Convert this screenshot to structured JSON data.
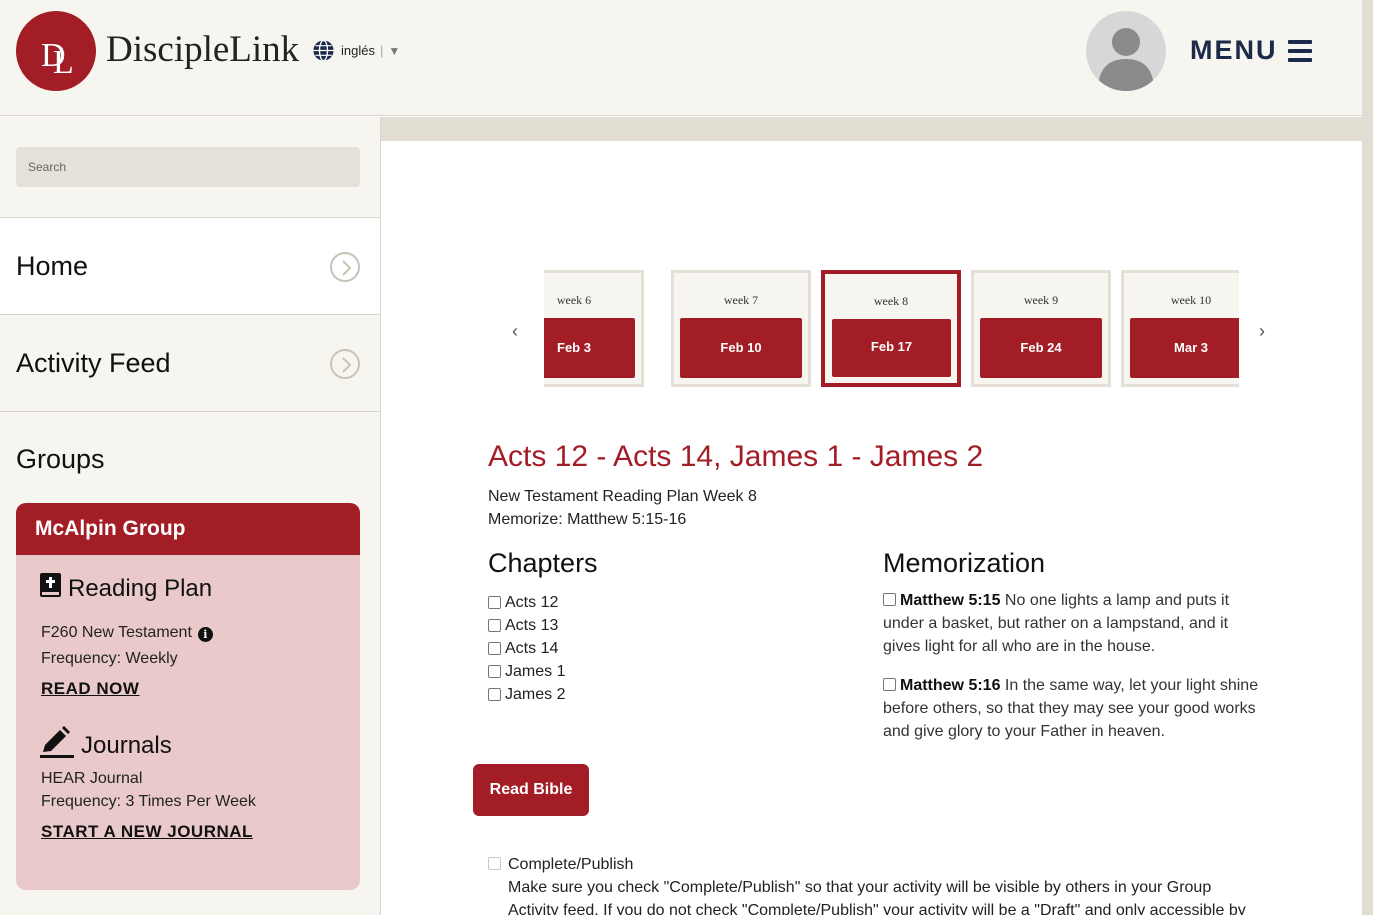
{
  "header": {
    "app_name": "DiscipleLink",
    "logo_letters": "DL",
    "language": "inglés",
    "menu_label": "MENU"
  },
  "sidebar": {
    "search_placeholder": "Search",
    "nav": [
      {
        "label": "Home"
      },
      {
        "label": "Activity Feed"
      }
    ],
    "groups_title": "Groups",
    "group": {
      "name": "McAlpin Group",
      "reading_plan": {
        "title": "Reading Plan",
        "plan_name": "F260 New Testament",
        "frequency": "Frequency: Weekly",
        "link": "READ NOW"
      },
      "journals": {
        "title": "Journals",
        "journal_name": "HEAR Journal",
        "frequency": "Frequency: 3 Times Per Week",
        "link": "START A NEW JOURNAL"
      }
    }
  },
  "main": {
    "weeks": [
      {
        "week": "week 6",
        "date": "Feb 3",
        "active": false
      },
      {
        "week": "week 7",
        "date": "Feb 10",
        "active": false
      },
      {
        "week": "week 8",
        "date": "Feb 17",
        "active": true
      },
      {
        "week": "week 9",
        "date": "Feb 24",
        "active": false
      },
      {
        "week": "week 10",
        "date": "Mar 3",
        "active": false
      }
    ],
    "passage_title": "Acts 12 - Acts 14, James 1 - James 2",
    "plan_week": "New Testament Reading Plan Week 8",
    "memorize": "Memorize: Matthew 5:15-16",
    "chapters_title": "Chapters",
    "chapters": [
      "Acts 12",
      "Acts 13",
      "Acts 14",
      "James 1",
      "James 2"
    ],
    "memorization_title": "Memorization",
    "verses": [
      {
        "ref": "Matthew 5:15",
        "text": "No one lights a lamp and puts it under a basket, but rather on a lampstand, and it gives light for all who are in the house."
      },
      {
        "ref": "Matthew 5:16",
        "text": "In the same way, let your light shine before others, so that they may see your good works and give glory to your Father in heaven."
      }
    ],
    "read_bible_label": "Read Bible",
    "complete_label": "Complete/Publish",
    "complete_note": "Make sure you check \"Complete/Publish\" so that your activity will be visible by others in your Group Activity feed. If you do not check \"Complete/Publish\" your activity will be a \"Draft\" and only accessible by"
  },
  "colors": {
    "brand_red": "#a31d26",
    "menu_navy": "#1b2a4a",
    "card_pink": "#e9c9c9",
    "sidebar_bg": "#f7f5f0"
  }
}
